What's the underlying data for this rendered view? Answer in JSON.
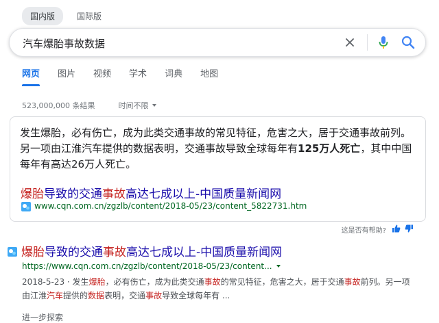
{
  "market_tabs": {
    "domestic": "国内版",
    "international": "国际版"
  },
  "search": {
    "query": "汽车爆胎事故数据"
  },
  "tabs": [
    "网页",
    "图片",
    "视频",
    "学术",
    "词典",
    "地图"
  ],
  "stats": {
    "count": "523,000,000 条结果",
    "time_filter": "时间不限"
  },
  "snippet": {
    "desc_1": "发生爆胎，必有伤亡，成为此类交通事故的常见特征，危害之大，居于交通事故前列。 另一项由江淮汽车提供的数据表明，交通事故导致全球每年有",
    "desc_bold": "125万人死亡",
    "desc_2": "，其中中国每年有高达26万人死亡。",
    "title_hl1": "爆胎",
    "title_mid": "导致的交通",
    "title_hl2": "事故",
    "title_rest": "高达七成以上-中国质量新闻网",
    "url": "www.cqn.com.cn/zgzlb/content/2018-05/23/content_5822731.htm"
  },
  "feedback": {
    "text": "这是否有帮助?"
  },
  "result": {
    "title_hl1": "爆胎",
    "title_mid": "导致的交通",
    "title_hl2": "事故",
    "title_rest": "高达七成以上-中国质量新闻网",
    "url": "https://www.cqn.com.cn/zgzlb/content/2018-05/23/content...",
    "date": "2018-5-23",
    "desc_parts": [
      {
        "t": " · 发生",
        "h": false
      },
      {
        "t": "爆胎",
        "h": true
      },
      {
        "t": "，必有伤亡，成为此类交通",
        "h": false
      },
      {
        "t": "事故",
        "h": true
      },
      {
        "t": "的常见特征，危害之大，居于交通",
        "h": false
      },
      {
        "t": "事故",
        "h": true
      },
      {
        "t": "前列。另一项由江淮",
        "h": false
      },
      {
        "t": "汽车",
        "h": true
      },
      {
        "t": "提供的",
        "h": false
      },
      {
        "t": "数据",
        "h": true
      },
      {
        "t": "表明，交通",
        "h": false
      },
      {
        "t": "事故",
        "h": true
      },
      {
        "t": "导致全球每年有 ...",
        "h": false
      }
    ]
  },
  "more": {
    "label": "进一步探索"
  },
  "colors": {
    "link": "#1a0dab",
    "url": "#006621",
    "accent": "#1a73e8",
    "highlight": "#c5221f"
  },
  "icons": {
    "clear": "close-icon",
    "voice": "microphone-icon",
    "search": "search-icon",
    "like": "thumbs-up-icon",
    "dislike": "thumbs-down-icon"
  }
}
